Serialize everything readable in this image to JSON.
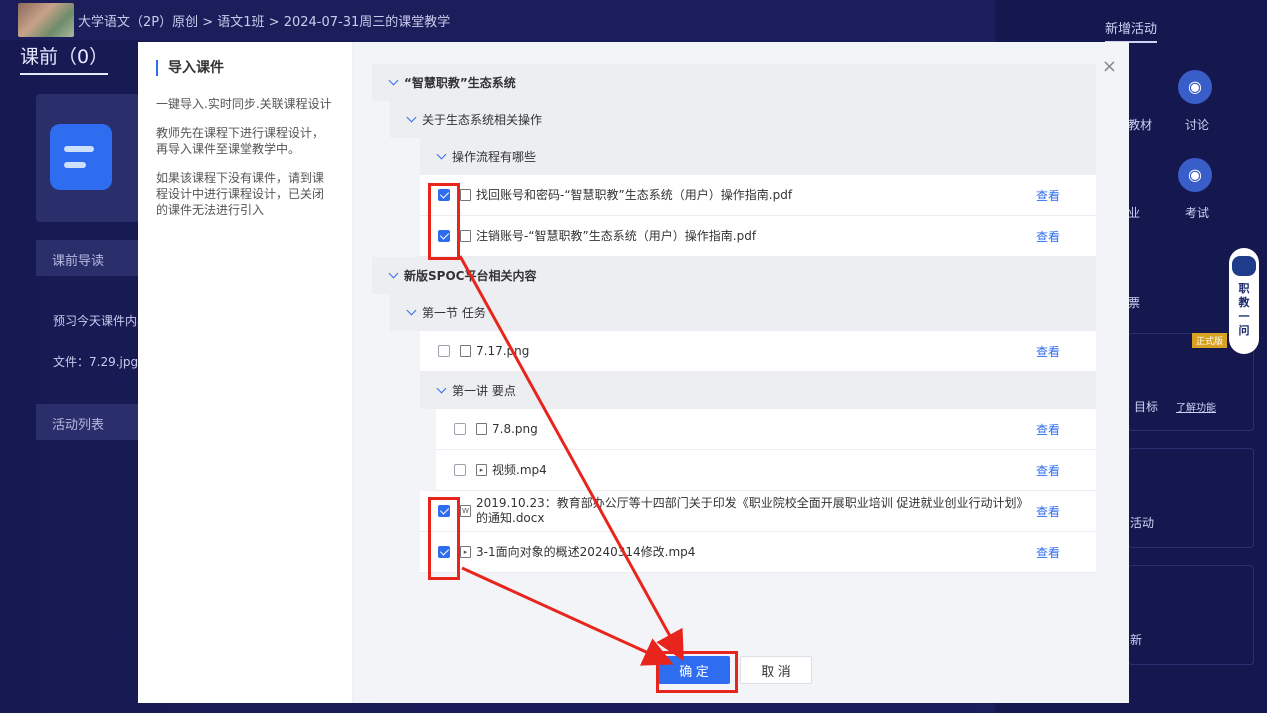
{
  "header": {
    "breadcrumb": "大学语文（2P）原创 > 语文1班 > 2024-07-31周三的课堂教学"
  },
  "page": {
    "pre_class_title": "课前（0）",
    "guide_label": "课前导读",
    "preview_text": "预习今天课件内容",
    "file_text": "文件：7.29.jpg",
    "activity_list_label": "活动列表"
  },
  "right_panel": {
    "title": "新增活动",
    "items": [
      {
        "label": "教材",
        "icon": "book-icon"
      },
      {
        "label": "讨论",
        "icon": "chat-icon"
      },
      {
        "label": "业",
        "icon": "homework-icon"
      },
      {
        "label": "考试",
        "icon": "exam-icon"
      },
      {
        "label": "票",
        "icon": "vote-icon"
      },
      {
        "label": "目标",
        "icon": "target-icon"
      },
      {
        "label": "了解功能",
        "icon": ""
      },
      {
        "label": "活动",
        "icon": "activity-icon"
      },
      {
        "label": "新",
        "icon": "refresh-icon"
      }
    ],
    "robot_label": "职教一问",
    "badge": "正式版"
  },
  "modal": {
    "title": "导入课件",
    "desc1": "一键导入.实时同步.关联课程设计",
    "desc2": "教师先在课程下进行课程设计，再导入课件至课堂教学中。",
    "desc3": "如果该课程下没有课件，请到课程设计中进行课程设计，已关闭的课件无法进行引入",
    "close": "×",
    "view_label": "查看",
    "tree": [
      {
        "type": "group",
        "level": 0,
        "label": "“智慧职教”生态系统",
        "bold": true
      },
      {
        "type": "group",
        "level": 1,
        "label": "关于生态系统相关操作",
        "bold": false
      },
      {
        "type": "group",
        "level": 2,
        "label": "操作流程有哪些",
        "bold": false
      },
      {
        "type": "file",
        "level": 2,
        "label": "找回账号和密码-“智慧职教”生态系统（用户）操作指南.pdf",
        "checked": true,
        "icon": "pdf-icon"
      },
      {
        "type": "file",
        "level": 2,
        "label": "注销账号-“智慧职教”生态系统（用户）操作指南.pdf",
        "checked": true,
        "icon": "pdf-icon"
      },
      {
        "type": "group",
        "level": 0,
        "label": "新版SPOC平台相关内容",
        "bold": true
      },
      {
        "type": "group",
        "level": 1,
        "label": "第一节 任务",
        "bold": false
      },
      {
        "type": "file",
        "level": 2,
        "label": "7.17.png",
        "checked": false,
        "icon": "image-icon"
      },
      {
        "type": "group",
        "level": 2,
        "label": "第一讲 要点",
        "bold": false
      },
      {
        "type": "file",
        "level": 3,
        "label": "7.8.png",
        "checked": false,
        "icon": "image-icon"
      },
      {
        "type": "file",
        "level": 3,
        "label": "视频.mp4",
        "checked": false,
        "icon": "video-icon"
      },
      {
        "type": "file",
        "level": 2,
        "label": "2019.10.23：教育部办公厅等十四部门关于印发《职业院校全面开展职业培训 促进就业创业行动计划》的通知.docx",
        "checked": true,
        "icon": "word-icon"
      },
      {
        "type": "file",
        "level": 2,
        "label": "3-1面向对象的概述20240314修改.mp4",
        "checked": true,
        "icon": "video-icon"
      }
    ],
    "confirm_label": "确 定",
    "cancel_label": "取 消"
  },
  "colors": {
    "accent": "#2f6df0",
    "annotation": "#e8251d",
    "background": "#1a1d5c"
  }
}
